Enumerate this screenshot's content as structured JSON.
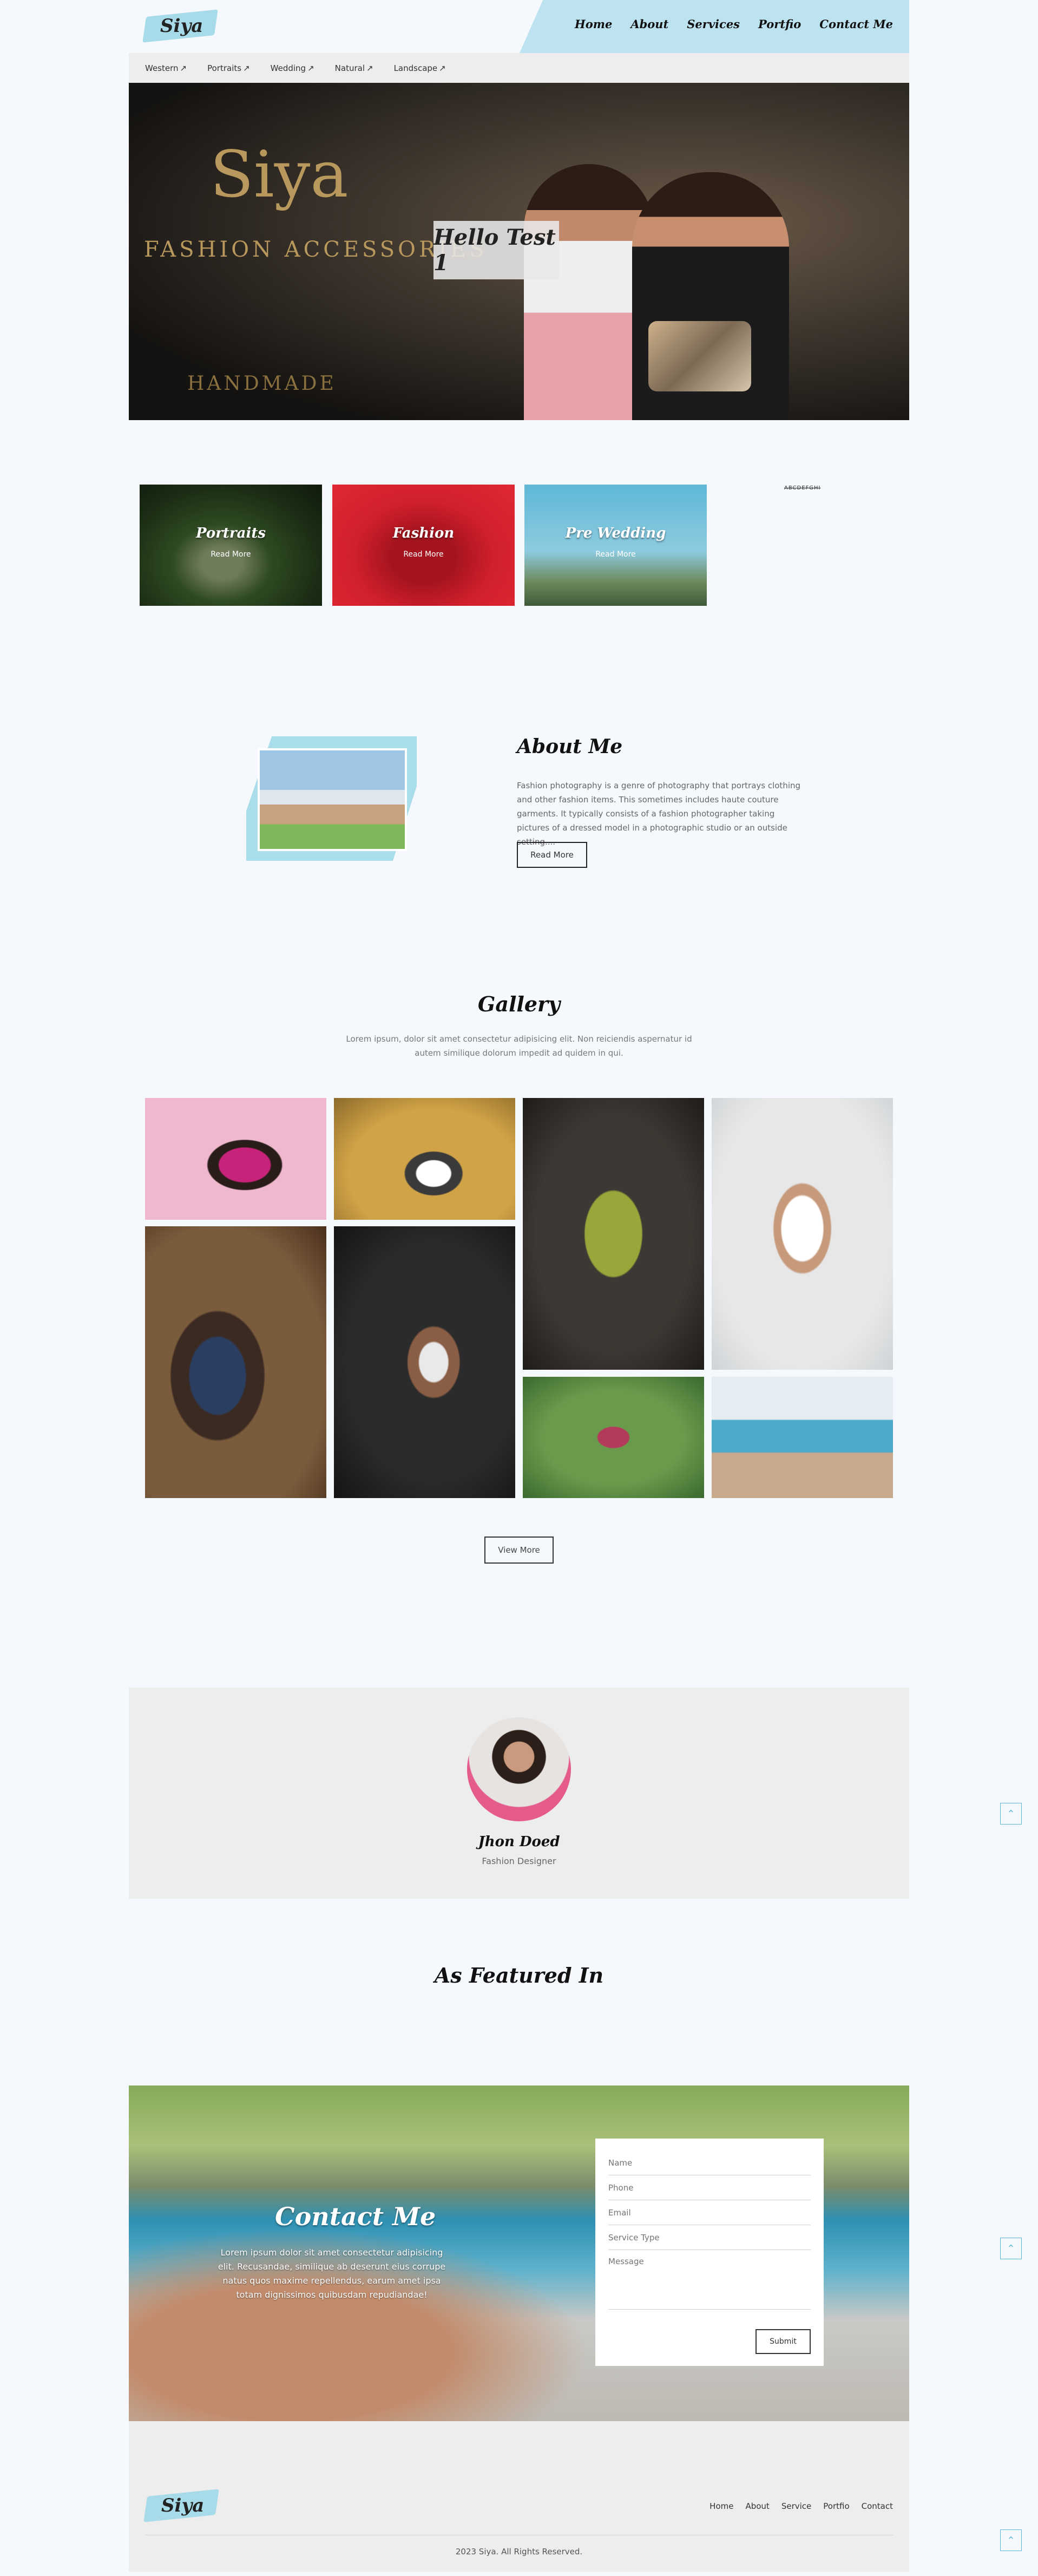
{
  "brand": {
    "logo_text": "Siya"
  },
  "nav": [
    "Home",
    "About",
    "Services",
    "Portfio",
    "Contact Me"
  ],
  "subnav": [
    "Western",
    "Portraits",
    "Wedding",
    "Natural",
    "Landscape"
  ],
  "hero": {
    "brand_text": "Siya",
    "tagline": "FASHION ACCESSORIES",
    "handmade": "HANDMADE",
    "card_title": "Hello Test 1"
  },
  "categories": [
    {
      "title": "Portraits",
      "link": "Read More"
    },
    {
      "title": "Fashion",
      "link": "Read More"
    },
    {
      "title": "Pre Wedding",
      "link": "Read More"
    }
  ],
  "categories_extra": "ABCDEFGHI",
  "about": {
    "title": "About Me",
    "text": "Fashion photography is a genre of photography that portrays clothing and other fashion items. This sometimes includes haute couture garments. It typically consists of a fashion photographer taking pictures of a dressed model in a photographic studio or an outside setting....",
    "button": "Read More"
  },
  "gallery": {
    "title": "Gallery",
    "description": "Lorem ipsum, dolor sit amet consectetur adipisicing elit. Non reiciendis aspernatur id autem similique dolorum impedit ad quidem in qui.",
    "button": "View More"
  },
  "profile": {
    "name": "Jhon Doed",
    "role": "Fashion Designer"
  },
  "featured": {
    "title": "As Featured In"
  },
  "contact": {
    "title": "Contact Me",
    "text": "Lorem ipsum dolor sit amet consectetur adipisicing elit. Recusandae, similique ab deserunt eius corrupe natus quos maxime repellendus, earum amet ipsa totam dignissimos quibusdam repudiandae!",
    "form": {
      "name_placeholder": "Name",
      "phone_placeholder": "Phone",
      "email_placeholder": "Email",
      "service_placeholder": "Service Type",
      "message_placeholder": "Message",
      "submit": "Submit"
    }
  },
  "footer": {
    "links": [
      "Home",
      "About",
      "Service",
      "Portfio",
      "Contact"
    ],
    "copyright": "2023 Siya. All Rights Reserved."
  },
  "scroll_top_icon": "chevron-up-icon",
  "colors": {
    "accent": "#bde3f0",
    "panel": "#ededed",
    "background": "#f5f9fd"
  }
}
